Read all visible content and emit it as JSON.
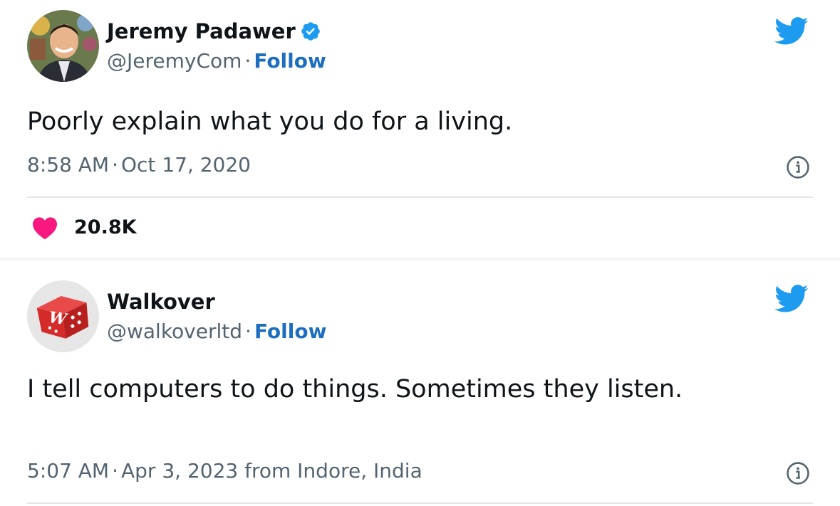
{
  "tweets": [
    {
      "author": {
        "name": "Jeremy Padawer",
        "handle": "@JeremyCom",
        "verified": true
      },
      "separator": "·",
      "follow_label": "Follow",
      "text": "Poorly explain what you do for a living.",
      "time": "8:58 AM",
      "date": "Oct 17, 2020",
      "likes": "20.8K"
    },
    {
      "author": {
        "name": "Walkover",
        "handle": "@walkoverltd",
        "verified": false,
        "avatar_letter": "W"
      },
      "separator": "·",
      "follow_label": "Follow",
      "text": "I tell computers to do things. Sometimes they listen.",
      "time": "5:07 AM",
      "date": "Apr 3, 2023 from Indore, India"
    }
  ],
  "icons": {
    "verified": "verified-badge-icon",
    "bird": "twitter-bird-icon",
    "info": "info-icon",
    "heart": "heart-icon"
  },
  "colors": {
    "twitter_blue": "#1d9bf0",
    "follow_link": "#1d6ec0",
    "heart": "#f91880",
    "secondary_text": "#536471",
    "walkover_red": "#d42a2a"
  }
}
